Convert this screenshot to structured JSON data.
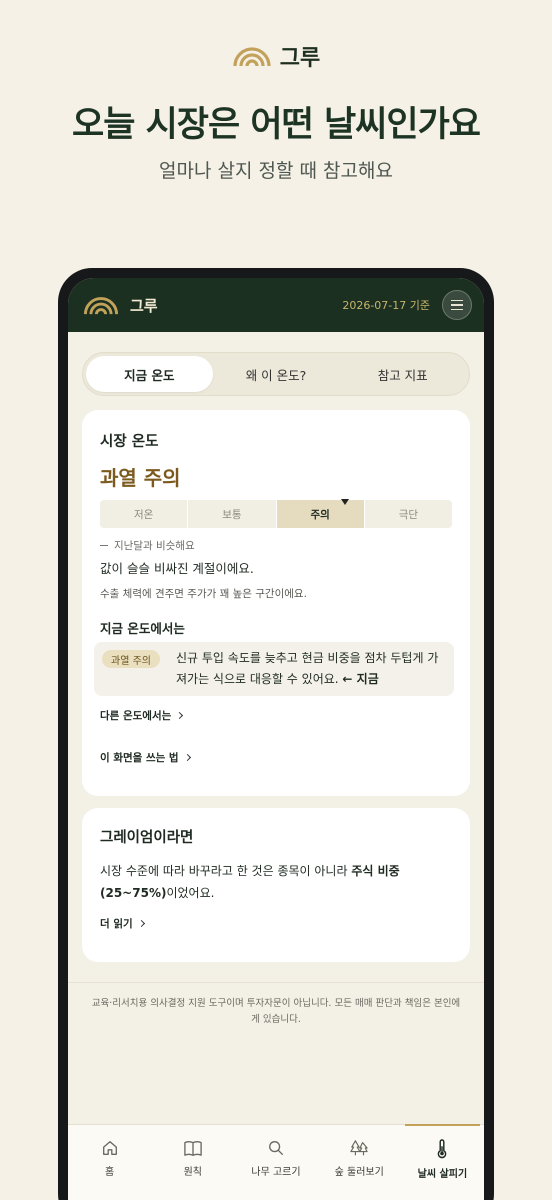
{
  "hero": {
    "brand_name": "그루",
    "title": "오늘 시장은 어떤 날씨인가요",
    "subtitle": "얼마나 살지 정할 때 참고해요"
  },
  "header": {
    "app_name": "그루",
    "date": "2026-07-17 기준",
    "menu_icon": "hamburger-icon"
  },
  "tabs": [
    {
      "label": "지금 온도",
      "active": true
    },
    {
      "label": "왜 이 온도?",
      "active": false
    },
    {
      "label": "참고 지표",
      "active": false
    }
  ],
  "market_card": {
    "title": "시장 온도",
    "value": "과열 주의",
    "scale": [
      "저온",
      "보통",
      "주의",
      "극단"
    ],
    "active_level": "주의",
    "trend": "지난달과 비슷해요",
    "description": "값이 슬슬 비싸진 계절이에요.",
    "detail": "수출 체력에 견주면 주가가 꽤 높은 구간이에요.",
    "section_title": "지금 온도에서는",
    "action_pill": "과열 주의",
    "action_text": "신규 투입 속도를 늦추고 현금 비중을 점차 두텁게 가져가는 식으로 대응할 수 있어요.",
    "action_now": "← 지금",
    "other_link": "다른 온도에서는",
    "howto_link": "이 화면을 쓰는 법"
  },
  "graham_card": {
    "title": "그레이엄이라면",
    "text_prefix": "시장 수준에 따라 바꾸라고 한 것은 종목이 아니라 ",
    "text_bold": "주식 비중 (25~75%)",
    "text_suffix": "이었어요.",
    "more_link": "더 읽기"
  },
  "disclaimer": "교육·리서치용 의사결정 지원 도구이며 투자자문이 아닙니다. 모든 매매 판단과 책임은 본인에게 있습니다.",
  "bottom_nav": [
    {
      "label": "홈",
      "icon": "home-icon",
      "active": false
    },
    {
      "label": "원칙",
      "icon": "book-icon",
      "active": false
    },
    {
      "label": "나무 고르기",
      "icon": "search-icon",
      "active": false
    },
    {
      "label": "숲 둘러보기",
      "icon": "trees-icon",
      "active": false
    },
    {
      "label": "날씨 살피기",
      "icon": "thermometer-icon",
      "active": true
    }
  ],
  "colors": {
    "header_bg": "#1b3021",
    "accent_gold": "#c2a25a",
    "warning_text": "#7c5a1e",
    "page_bg": "#f5f1e7"
  }
}
